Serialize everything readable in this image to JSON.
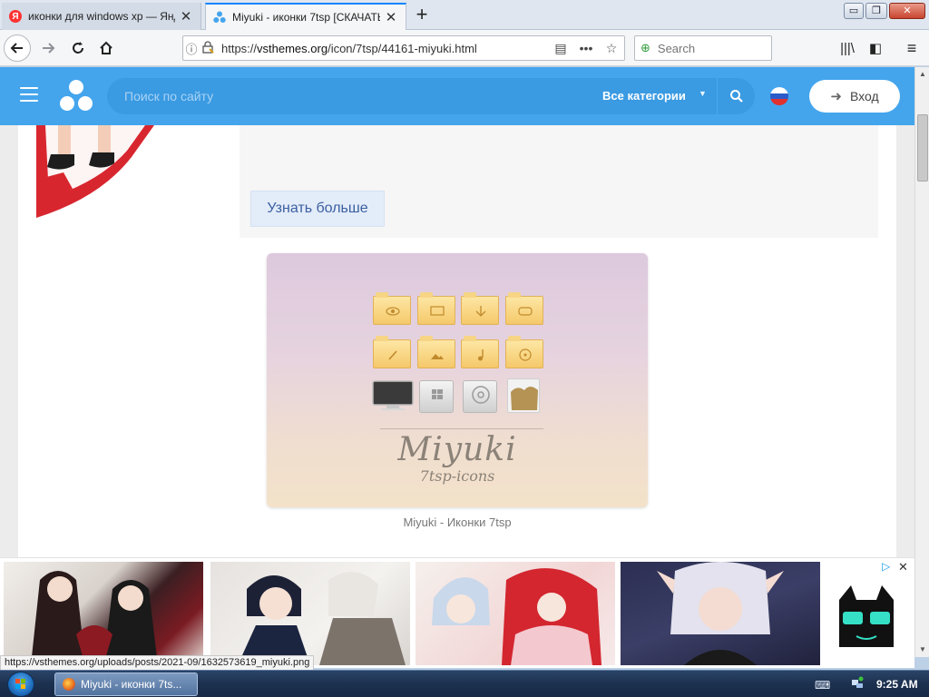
{
  "browser": {
    "tabs": [
      {
        "title": "иконки для windows xp — Янд",
        "favicon": "yandex-icon",
        "active": false
      },
      {
        "title": "Miyuki - иконки 7tsp [СКАЧАТЬ",
        "favicon": "vsthemes-icon",
        "active": true
      }
    ],
    "new_tab_label": "+",
    "window_controls": {
      "minimize": "▭",
      "maximize": "❐",
      "close": "✕"
    },
    "url": {
      "scheme": "https://",
      "host": "vsthemes.org",
      "path": "/icon/7tsp/44161-miyuki.html"
    },
    "search": {
      "placeholder": "Search",
      "value": ""
    }
  },
  "site": {
    "search_placeholder": "Поиск по сайту",
    "category_select": "Все категории",
    "login_label": "Вход",
    "language": "ru"
  },
  "content": {
    "more_button": "Узнать больше",
    "preview": {
      "logo_text": "Miyuki",
      "logo_sub": "7tsp-icons",
      "caption": "Miyuki - Иконки 7tsp"
    }
  },
  "ads": {
    "choices_label": "▷",
    "close_label": "✕"
  },
  "status_link": "https://vsthemes.org/uploads/posts/2021-09/1632573619_miyuki.png",
  "taskbar": {
    "task_label": "Miyuki - иконки 7ts...",
    "clock": "9:25 AM"
  },
  "colors": {
    "site_header": "#44a5ed",
    "more_button_text": "#3a5fa0",
    "accent_tab": "#0a84ff"
  }
}
